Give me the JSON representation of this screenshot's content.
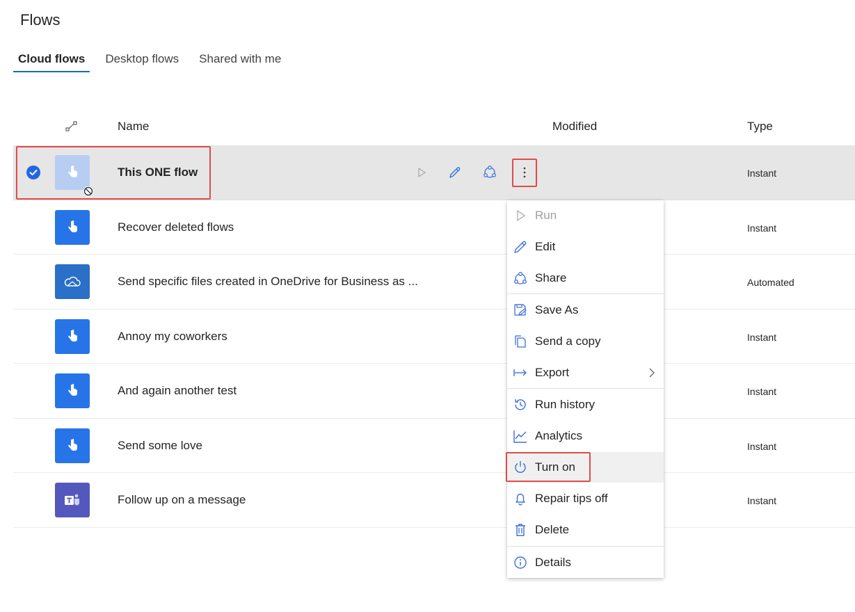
{
  "page": {
    "title": "Flows"
  },
  "tabs": [
    {
      "label": "Cloud flows",
      "active": true
    },
    {
      "label": "Desktop flows",
      "active": false
    },
    {
      "label": "Shared with me",
      "active": false
    }
  ],
  "columns": {
    "icon_col": "connector-icon",
    "name": "Name",
    "modified": "Modified",
    "type": "Type"
  },
  "rows": [
    {
      "name": "This ONE flow",
      "type": "Instant",
      "icon": "touch-icon",
      "selected": true,
      "disabled": true
    },
    {
      "name": "Recover deleted flows",
      "type": "Instant",
      "icon": "touch-icon"
    },
    {
      "name": "Send specific files created in OneDrive for Business as ...",
      "type": "Automated",
      "icon": "onedrive-icon"
    },
    {
      "name": "Annoy my coworkers",
      "type": "Instant",
      "icon": "touch-icon"
    },
    {
      "name": "And again another test",
      "type": "Instant",
      "icon": "touch-icon"
    },
    {
      "name": "Send some love",
      "type": "Instant",
      "icon": "touch-icon"
    },
    {
      "name": "Follow up on a message",
      "type": "Instant",
      "icon": "teams-icon"
    }
  ],
  "menu": {
    "items": [
      {
        "label": "Run",
        "icon": "play-icon",
        "disabled": true
      },
      {
        "label": "Edit",
        "icon": "pencil-icon"
      },
      {
        "label": "Share",
        "icon": "share-icon"
      },
      {
        "label": "Save As",
        "icon": "save-as-icon"
      },
      {
        "label": "Send a copy",
        "icon": "copy-icon"
      },
      {
        "label": "Export",
        "icon": "export-icon",
        "submenu": true
      },
      {
        "label": "Run history",
        "icon": "history-icon"
      },
      {
        "label": "Analytics",
        "icon": "analytics-icon"
      },
      {
        "label": "Turn on",
        "icon": "power-icon",
        "hover": true
      },
      {
        "label": "Repair tips off",
        "icon": "bell-icon"
      },
      {
        "label": "Delete",
        "icon": "trash-icon"
      },
      {
        "label": "Details",
        "icon": "info-icon"
      }
    ]
  },
  "colors": {
    "accent": "#0f6cbd",
    "flow_blue": "#2674e8",
    "highlight": "#e24a4a",
    "icon_blue": "#3b6fd8"
  }
}
